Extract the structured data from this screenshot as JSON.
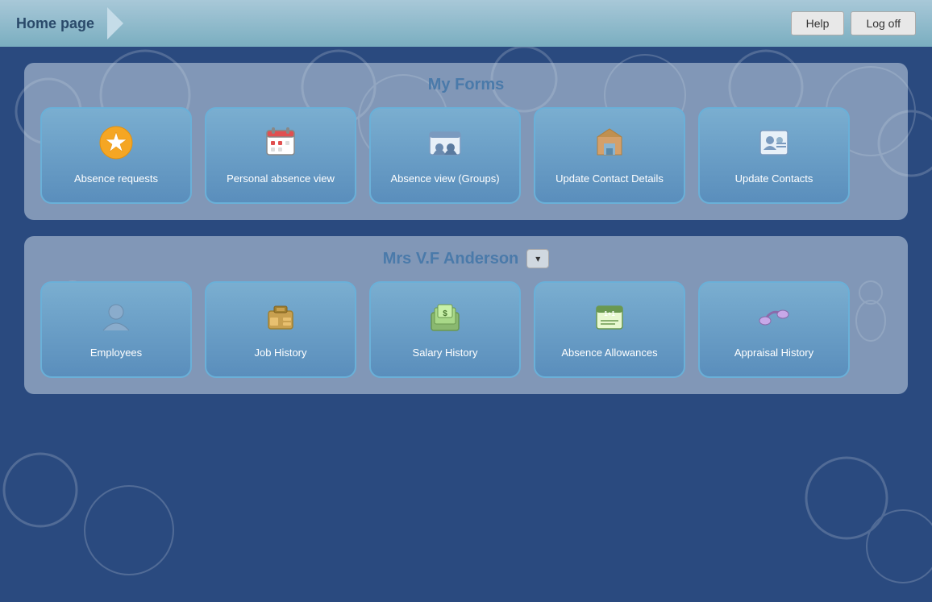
{
  "header": {
    "title": "Home page",
    "help_label": "Help",
    "logoff_label": "Log off"
  },
  "my_forms": {
    "title": "My Forms",
    "cards": [
      {
        "id": "absence-requests",
        "label": "Absence requests",
        "icon": "⭐"
      },
      {
        "id": "personal-absence-view",
        "label": "Personal absence view",
        "icon": "📅"
      },
      {
        "id": "absence-view-groups",
        "label": "Absence view (Groups)",
        "icon": "👥"
      },
      {
        "id": "update-contact-details",
        "label": "Update Contact Details",
        "icon": "🏠"
      },
      {
        "id": "update-contacts",
        "label": "Update Contacts",
        "icon": "📋"
      }
    ]
  },
  "person_section": {
    "title": "Mrs V.F Anderson",
    "cards": [
      {
        "id": "employees",
        "label": "Employees",
        "icon": "👤"
      },
      {
        "id": "job-history",
        "label": "Job History",
        "icon": "💼"
      },
      {
        "id": "salary-history",
        "label": "Salary History",
        "icon": "💵"
      },
      {
        "id": "absence-allowances",
        "label": "Absence Allowances",
        "icon": "🪧"
      },
      {
        "id": "appraisal-history",
        "label": "Appraisal History",
        "icon": "🤝"
      }
    ]
  }
}
